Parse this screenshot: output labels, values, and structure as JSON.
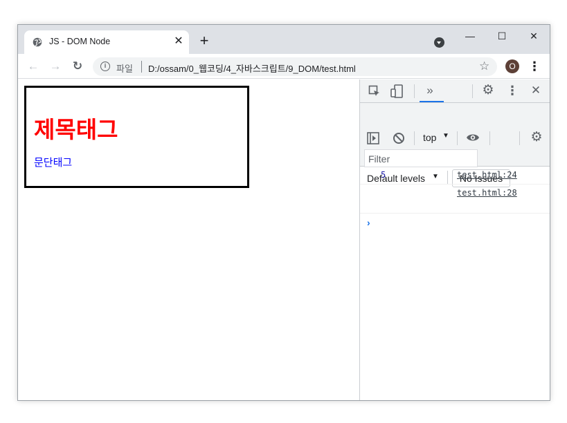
{
  "browser": {
    "tab": {
      "title": "JS - DOM Node",
      "close_symbol": "✕"
    },
    "new_tab_symbol": "+",
    "window_controls": {
      "minimize": "—",
      "maximize": "☐",
      "close": "✕"
    },
    "nav": {
      "back": "←",
      "forward": "→",
      "reload": "↻"
    },
    "address": {
      "scheme_label": "파일",
      "url": "D:/ossam/0_웹코딩/4_자바스크립트/9_DOM/test.html",
      "star_symbol": "☆"
    },
    "profile_initial": "O",
    "menu_symbol": "⋮"
  },
  "page": {
    "heading": "제목태그",
    "paragraph": "문단태그",
    "colors": {
      "heading": "#ff0000",
      "paragraph": "#0000ff",
      "box_border": "#000000"
    }
  },
  "devtools": {
    "toolbar": {
      "inspect_icon": "inspect-element-icon",
      "device_icon": "device-toggle-icon",
      "more_tabs_symbol": "»",
      "settings_symbol": "⚙",
      "menu_symbol": "⋮",
      "close_symbol": "✕"
    },
    "console_toolbar": {
      "sidebar_symbol": "▶",
      "clear_symbol": "⊘",
      "context": "top",
      "context_caret": "▼",
      "eye_symbol": "👁",
      "settings_symbol": "⚙",
      "filter_placeholder": "Filter",
      "levels_label": "Default levels",
      "levels_caret": "▼",
      "issues_label": "No Issues"
    },
    "console": {
      "messages": [
        {
          "value": "5",
          "source": "test.html:24"
        },
        {
          "value": "",
          "source": "test.html:28"
        }
      ],
      "prompt_symbol": "›"
    },
    "accent_color": "#1a73e8"
  }
}
